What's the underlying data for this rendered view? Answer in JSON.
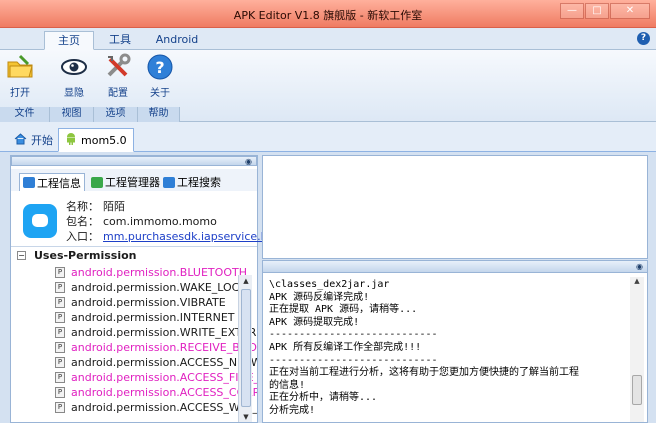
{
  "window": {
    "title": "APK Editor V1.8 旗舰版 - 新软工作室"
  },
  "ribbon": {
    "tabs": [
      {
        "label": "主页",
        "active": true
      },
      {
        "label": "工具",
        "active": false
      },
      {
        "label": "Android",
        "active": false
      }
    ],
    "buttons": [
      {
        "label": "打开",
        "icon": "folder-icon"
      },
      {
        "label": "显隐",
        "icon": "eye-icon"
      },
      {
        "label": "配置",
        "icon": "tools-icon"
      },
      {
        "label": "关于",
        "icon": "help-icon"
      }
    ],
    "groups": [
      "文件",
      "视图",
      "选项",
      "帮助"
    ]
  },
  "doc_tabs": [
    {
      "label": "开始",
      "icon": "home-icon",
      "active": false
    },
    {
      "label": "mom5.0",
      "icon": "android-icon",
      "active": true
    }
  ],
  "left_panel": {
    "subtabs": [
      {
        "label": "工程信息",
        "active": true
      },
      {
        "label": "工程管理器",
        "active": false
      },
      {
        "label": "工程搜索",
        "active": false
      }
    ],
    "app": {
      "name_key": "名称：",
      "name": "陌陌",
      "package_key": "包名：",
      "package": "com.immomo.momo",
      "entry_key": "入口：",
      "entry": "mm.purchasesdk.iapservice.P..."
    },
    "permissions_header": "Uses-Permission",
    "permissions": [
      {
        "name": "android.permission.BLUETOOTH",
        "highlight": true
      },
      {
        "name": "android.permission.WAKE_LOCK",
        "highlight": false
      },
      {
        "name": "android.permission.VIBRATE",
        "highlight": false
      },
      {
        "name": "android.permission.INTERNET",
        "highlight": false
      },
      {
        "name": "android.permission.WRITE_EXTERI",
        "highlight": false
      },
      {
        "name": "android.permission.RECEIVE_BOO",
        "highlight": true
      },
      {
        "name": "android.permission.ACCESS_NETW",
        "highlight": false
      },
      {
        "name": "android.permission.ACCESS_FINE_",
        "highlight": true
      },
      {
        "name": "android.permission.ACCESS_COAR",
        "highlight": true
      },
      {
        "name": "android.permission.ACCESS_WIFI_",
        "highlight": false
      }
    ]
  },
  "console": {
    "lines": [
      "\\classes_dex2jar.jar",
      "APK 源码反编译完成!",
      "正在提取 APK 源码，请稍等...",
      "APK 源码提取完成!",
      "----------------------------",
      "APK 所有反编译工作全部完成!!!",
      "----------------------------",
      "正在对当前工程进行分析，这将有助于您更加方便快捷的了解当前工程",
      "的信息!",
      "正在分析中，请稍等...",
      "分析完成!"
    ]
  },
  "colors": {
    "title_bar": "#ef7b62",
    "ribbon_text": "#15428b",
    "permission_highlight": "#e020c0",
    "link": "#1e40c8"
  }
}
